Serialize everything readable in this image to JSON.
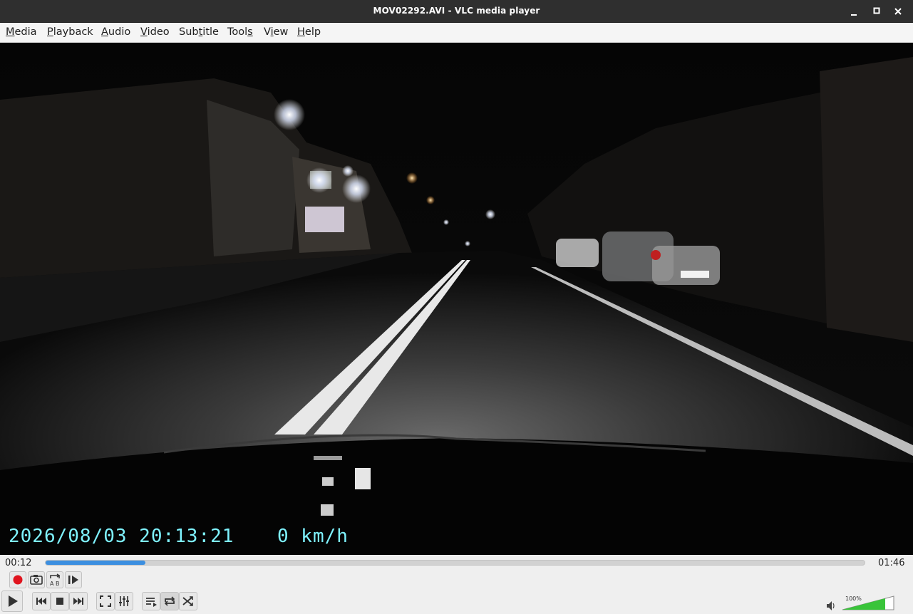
{
  "window": {
    "title": "MOV02292.AVI - VLC media player"
  },
  "menubar": {
    "items": [
      {
        "accel": "M",
        "rest": "edia"
      },
      {
        "accel": "P",
        "rest": "layback"
      },
      {
        "accel": "A",
        "rest": "udio"
      },
      {
        "accel": "V",
        "rest": "ideo"
      },
      {
        "accel": "S",
        "pre": "Sub",
        "accel2": "t",
        "rest": "itle"
      },
      {
        "accel": "",
        "pre": "Tool",
        "accel2": "s",
        "rest": ""
      },
      {
        "accel": "V",
        "pre": "",
        "accel2": "",
        "rest": "iew"
      },
      {
        "accel": "H",
        "rest": "elp"
      }
    ],
    "labels": [
      "Media",
      "Playback",
      "Audio",
      "Video",
      "Subtitle",
      "Tools",
      "View",
      "Help"
    ]
  },
  "video": {
    "osd_datetime": "2026/08/03 20:13:21",
    "osd_speed": "0 km/h"
  },
  "playback": {
    "elapsed": "00:12",
    "total": "01:46",
    "progress_fraction": 0.122
  },
  "volume": {
    "label": "100%",
    "level": 1.0
  },
  "icons": {
    "record": "record-icon",
    "snapshot": "camera-icon",
    "loop_ab": "loop-ab-icon",
    "frame_step": "frame-step-icon",
    "play": "play-icon",
    "previous": "previous-icon",
    "stop": "stop-icon",
    "next": "next-icon",
    "fullscreen": "fullscreen-icon",
    "extended": "equalizer-icon",
    "playlist": "playlist-icon",
    "loop": "loop-icon",
    "shuffle": "shuffle-icon",
    "speaker": "speaker-icon"
  },
  "colors": {
    "accent": "#3c8fe0",
    "record": "#e0141e",
    "osd": "#7ff3ff",
    "volume": "#39c43a"
  }
}
